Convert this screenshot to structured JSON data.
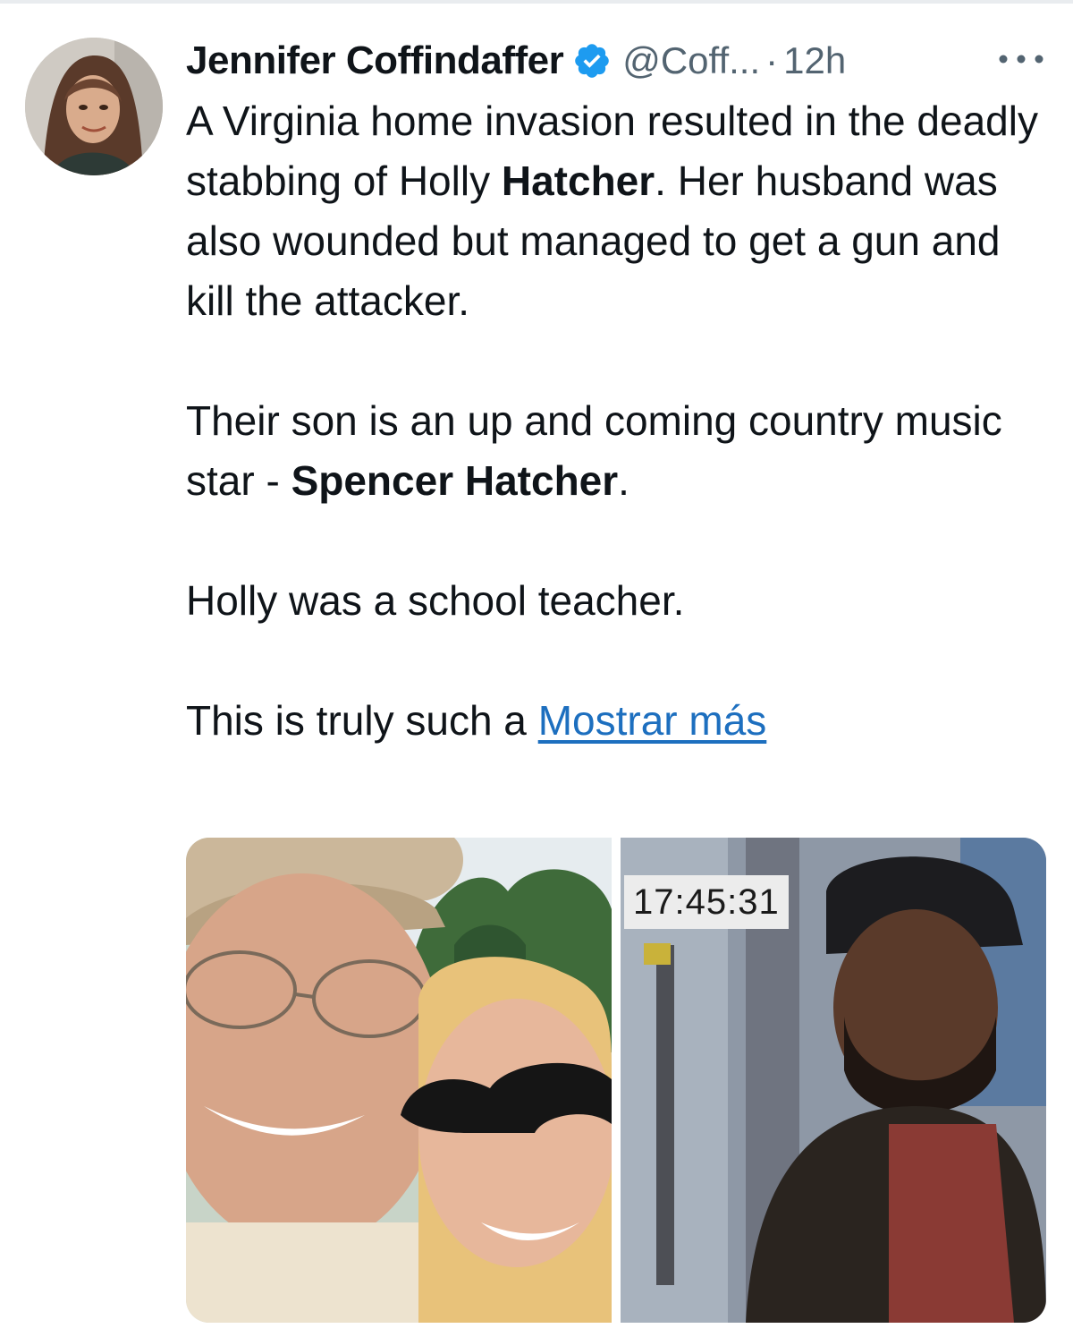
{
  "tweet": {
    "author": {
      "display_name": "Jennifer Coffindaffer",
      "handle": "@Coff...",
      "verified": true,
      "avatar_icon": "profile-photo"
    },
    "separator": "·",
    "time": "12h",
    "more_icon": "ellipsis-icon",
    "text": {
      "p1_a": "A Virginia home invasion resulted in the deadly stabbing of Holly ",
      "p1_bold": "Hatcher",
      "p1_b": ". Her husband was also wounded but managed to get a gun and kill the attacker.",
      "p2_a": "Their son is an up and coming country music star - ",
      "p2_bold": "Spencer Hatcher",
      "p2_b": ".",
      "p3": "Holly was a school teacher.",
      "p4": "This is truly such a ",
      "show_more": "Mostrar más"
    },
    "media": {
      "photos": [
        {
          "name": "couple-selfie-photo"
        },
        {
          "name": "surveillance-still-photo",
          "timestamp": "17:45:31"
        }
      ]
    },
    "colors": {
      "text": "#0f1419",
      "secondary": "#536471",
      "link": "#1d6fbf",
      "verified": "#1d9bf0"
    }
  }
}
